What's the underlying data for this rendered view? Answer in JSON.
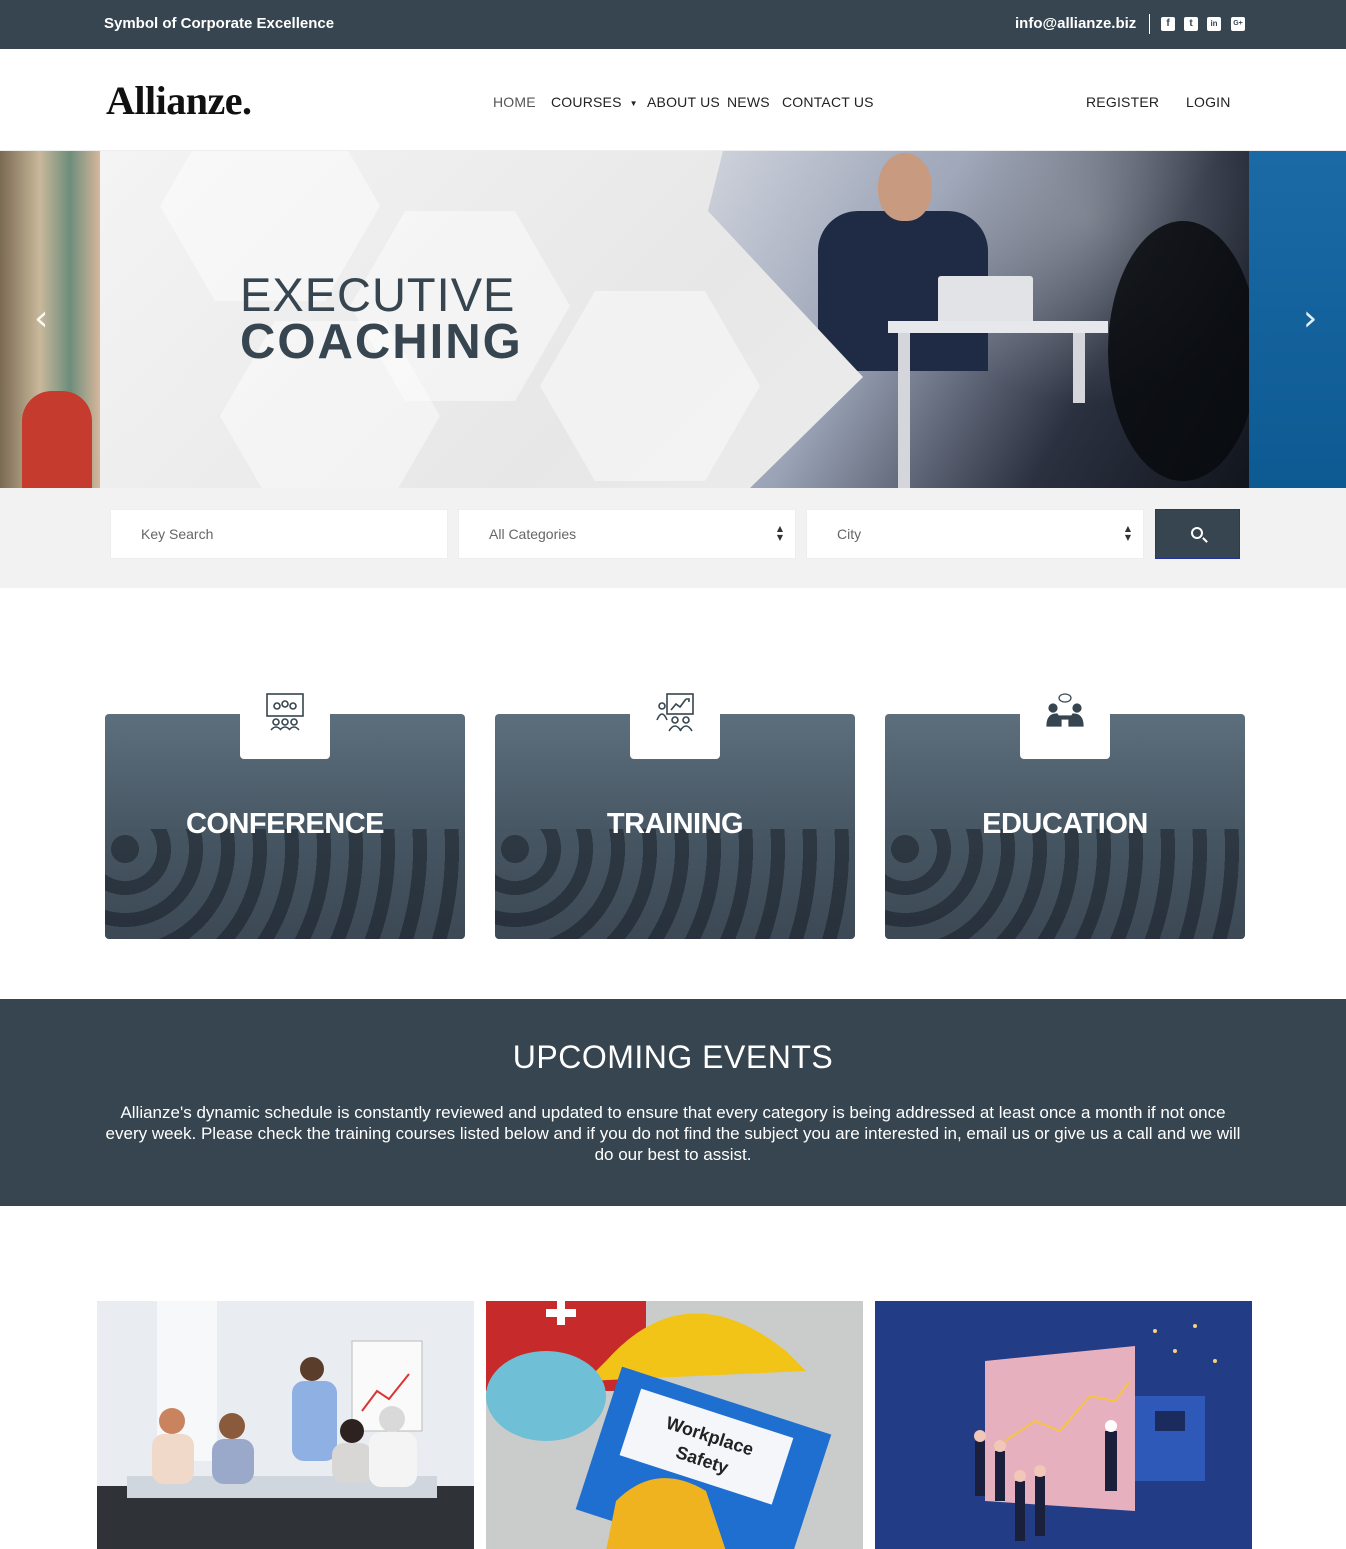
{
  "topbar": {
    "tagline": "Symbol of Corporate Excellence",
    "email": "info@allianze.biz",
    "social": [
      {
        "icon": "facebook-icon",
        "glyph": "f"
      },
      {
        "icon": "twitter-icon",
        "glyph": "t"
      },
      {
        "icon": "linkedin-icon",
        "glyph": "in"
      },
      {
        "icon": "google-plus-icon",
        "glyph": "G+"
      }
    ]
  },
  "header": {
    "logo": "Allianze.",
    "nav": [
      "HOME",
      "COURSES",
      "ABOUT US",
      "NEWS",
      "CONTACT US"
    ],
    "register": "REGISTER",
    "login": "LOGIN"
  },
  "hero": {
    "title_line1": "EXECUTIVE",
    "title_line2": "COACHING",
    "prev_arrow": "‹",
    "next_arrow": "›"
  },
  "search": {
    "keyword_placeholder": "Key Search",
    "category_value": "All Categories",
    "city_value": "City"
  },
  "categories": [
    {
      "label": "CONFERENCE",
      "icon": "conference-icon"
    },
    {
      "label": "TRAINING",
      "icon": "training-icon"
    },
    {
      "label": "EDUCATION",
      "icon": "education-icon"
    }
  ],
  "events": {
    "title": "UPCOMING EVENTS",
    "description": "Allianze's dynamic schedule is constantly reviewed and updated to ensure that every category is being addressed at least once a month if not once every week. Please check the training courses listed below and if you do not find the subject you are interested in, email us or give us a call and we will do our best to assist."
  },
  "event_images": [
    {
      "name": "business-meeting-image"
    },
    {
      "name": "workplace-safety-image",
      "text": "Workplace Safety"
    },
    {
      "name": "data-presentation-illustration"
    }
  ],
  "colors": {
    "dark": "#36454f",
    "light_bg": "#f2f2f2",
    "accent_border": "#23309a"
  }
}
